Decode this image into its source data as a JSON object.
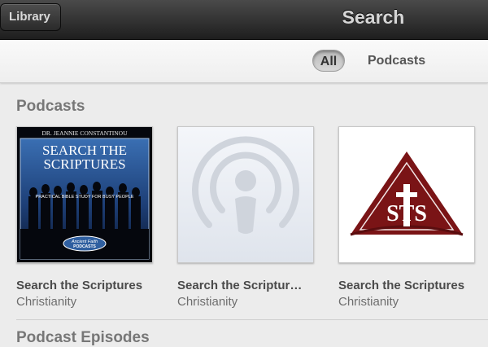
{
  "topbar": {
    "library_label": "Library",
    "title": "Search"
  },
  "segments": {
    "all": "All",
    "podcasts": "Podcasts"
  },
  "sections": {
    "podcasts": "Podcasts",
    "episodes": "Podcast Episodes"
  },
  "cards": [
    {
      "title": "Search the Scriptures",
      "subtitle": "Christianity",
      "art": {
        "top": "DR. JEANNIE CONSTANTINOU",
        "line1": "SEARCH THE",
        "line2": "SCRIPTURES",
        "tagline": "PRACTICAL BIBLE STUDY FOR BUSY PEOPLE",
        "badge1": "Ancient Faith",
        "badge2": "PODCASTS"
      }
    },
    {
      "title": "Search the Scriptur…",
      "subtitle": "Christianity",
      "art": {
        "icon": "podcast-icon"
      }
    },
    {
      "title": "Search the Scriptures",
      "subtitle": "Christianity",
      "art": {
        "logo": "sts-logo",
        "letters": "STS"
      }
    }
  ],
  "colors": {
    "topbar": "#2a2a2a",
    "maroon": "#7a1416",
    "navy": "#1d3f77"
  }
}
